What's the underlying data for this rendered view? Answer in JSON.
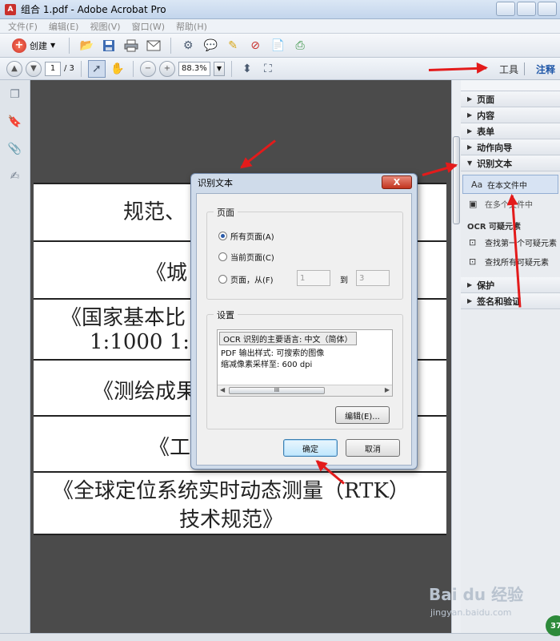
{
  "window": {
    "title": "组合 1.pdf - Adobe Acrobat Pro",
    "app_icon": "pdf-icon"
  },
  "menu": [
    "文件(F)",
    "编辑(E)",
    "视图(V)",
    "窗口(W)",
    "帮助(H)"
  ],
  "toolbar": {
    "create_label": "创建"
  },
  "nav": {
    "page_current": "1",
    "page_total": "/ 3",
    "zoom": "88.3%"
  },
  "tabs": {
    "tools": "工具",
    "comment": "注释"
  },
  "document": {
    "rows": [
      "规范、",
      "《城",
      "《国家基本比",
      "1:1000  1:",
      "《测绘成果",
      "《工",
      "《全球定位系统实时动态测量（RTK）",
      "技术规范》"
    ],
    "right_fragment": ")"
  },
  "right_panel": {
    "sections_top": [
      "页面",
      "内容",
      "表单",
      "动作向导"
    ],
    "ocr_section": "识别文本",
    "ocr_items": [
      "在本文件中",
      "在多个文件中"
    ],
    "suspects_header": "OCR 可疑元素",
    "suspect_items": [
      "查找第一个可疑元素",
      "查找所有可疑元素"
    ],
    "sections_bottom": [
      "保护",
      "签名和验证"
    ]
  },
  "dialog": {
    "title": "识别文本",
    "close_label": "X",
    "pages_group": "页面",
    "radio_all": "所有页面(A)",
    "radio_current": "当前页面(C)",
    "radio_from": "页面，从(F)",
    "from_value": "1",
    "to_label": "到",
    "to_value": "3",
    "settings_group": "设置",
    "settings_lines": [
      "OCR 识别的主要语言: 中文（简体）",
      "PDF 输出样式: 可搜索的图像",
      "缩减像素采样至: 600 dpi"
    ],
    "scroll_thumb": "III",
    "edit_button": "编辑(E)...",
    "ok_button": "确定",
    "cancel_button": "取消"
  },
  "watermark": {
    "brand": "Bai du 经验",
    "url": "jingyan.baidu.com",
    "badge": "37"
  },
  "colors": {
    "arrow": "#e31b1b",
    "accent": "#1f57a8"
  }
}
